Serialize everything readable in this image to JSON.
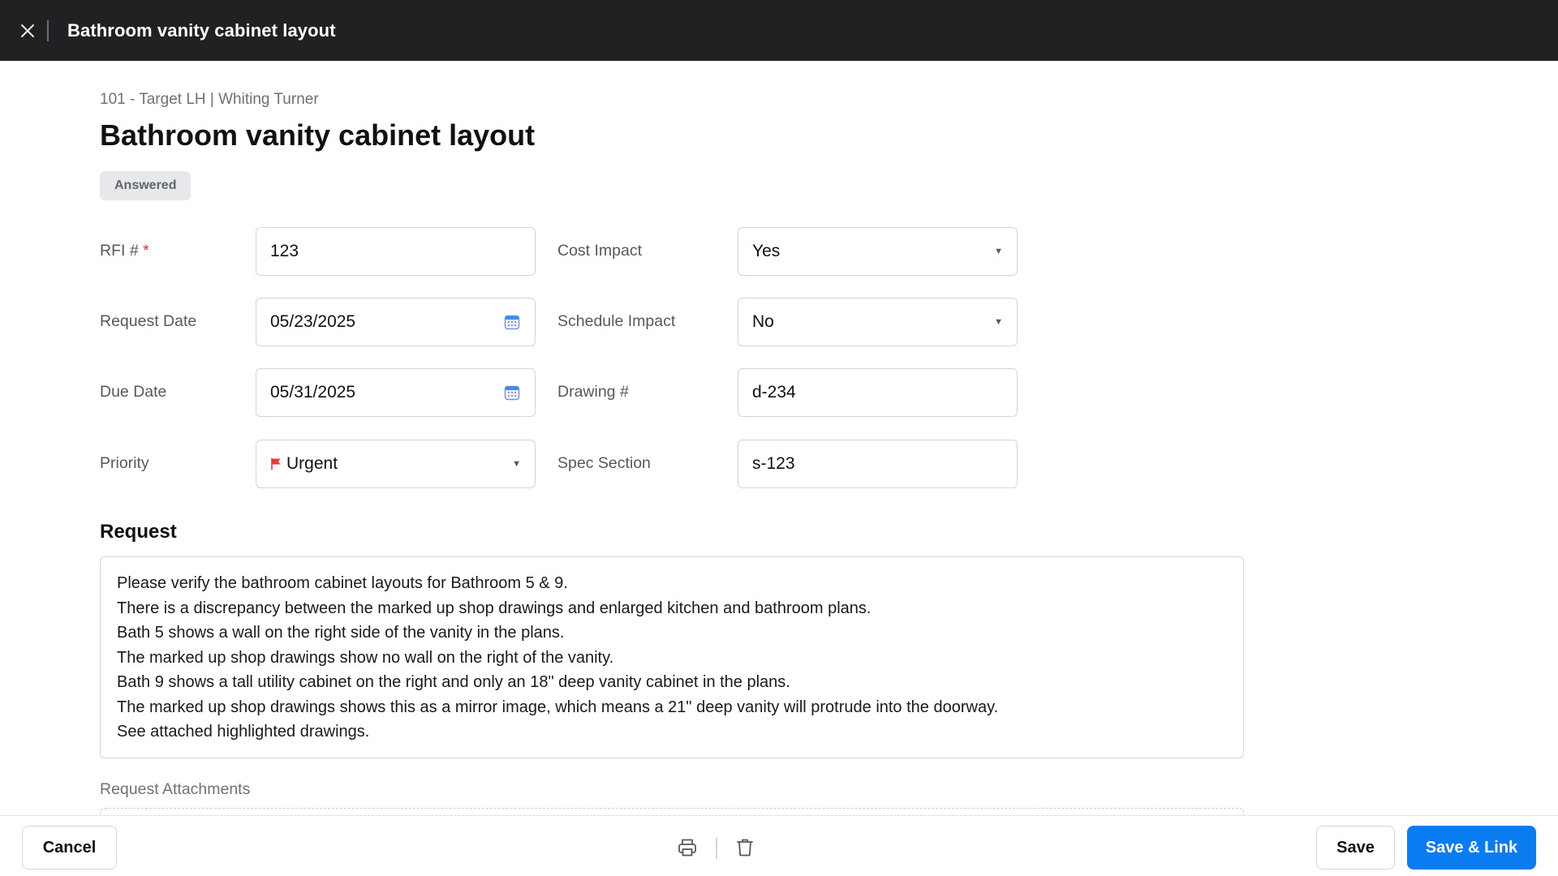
{
  "window": {
    "title": "Bathroom vanity cabinet layout"
  },
  "header": {
    "breadcrumb": "101 - Target LH | Whiting Turner",
    "title": "Bathroom vanity cabinet layout",
    "status": "Answered"
  },
  "fields": {
    "rfi_number": {
      "label": "RFI #",
      "required_mark": "*",
      "value": "123"
    },
    "request_date": {
      "label": "Request Date",
      "value": "05/23/2025",
      "icon": "calendar-icon"
    },
    "due_date": {
      "label": "Due Date",
      "value": "05/31/2025",
      "icon": "calendar-icon"
    },
    "priority": {
      "label": "Priority",
      "value": "Urgent",
      "icon": "flag-icon",
      "flag_color": "#e5383b"
    },
    "cost_impact": {
      "label": "Cost Impact",
      "value": "Yes"
    },
    "schedule_impact": {
      "label": "Schedule Impact",
      "value": "No"
    },
    "drawing_number": {
      "label": "Drawing #",
      "value": "d-234"
    },
    "spec_section": {
      "label": "Spec Section",
      "value": "s-123"
    }
  },
  "request": {
    "heading": "Request",
    "lines": [
      "Please verify the bathroom cabinet layouts for Bathroom 5 & 9.",
      "There is a discrepancy between the marked up shop drawings and enlarged kitchen and bathroom plans.",
      "Bath 5 shows a wall on the right side of the vanity in the plans.",
      "The marked up shop drawings show no wall on the right of the vanity.",
      "Bath 9 shows a tall utility cabinet on the right and only an 18\" deep vanity cabinet in the plans.",
      "The marked up shop drawings shows this as a mirror image, which means a 21\" deep vanity will protrude into the doorway.",
      "See attached highlighted drawings."
    ],
    "attachments_label": "Request Attachments"
  },
  "footer": {
    "cancel_label": "Cancel",
    "save_label": "Save",
    "save_link_label": "Save & Link",
    "print_icon": "print-icon",
    "delete_icon": "trash-icon"
  },
  "colors": {
    "topbar": "#1f2123",
    "primary": "#0a7cf2",
    "badge_bg": "#e6e8eb",
    "required": "#e0342e"
  }
}
